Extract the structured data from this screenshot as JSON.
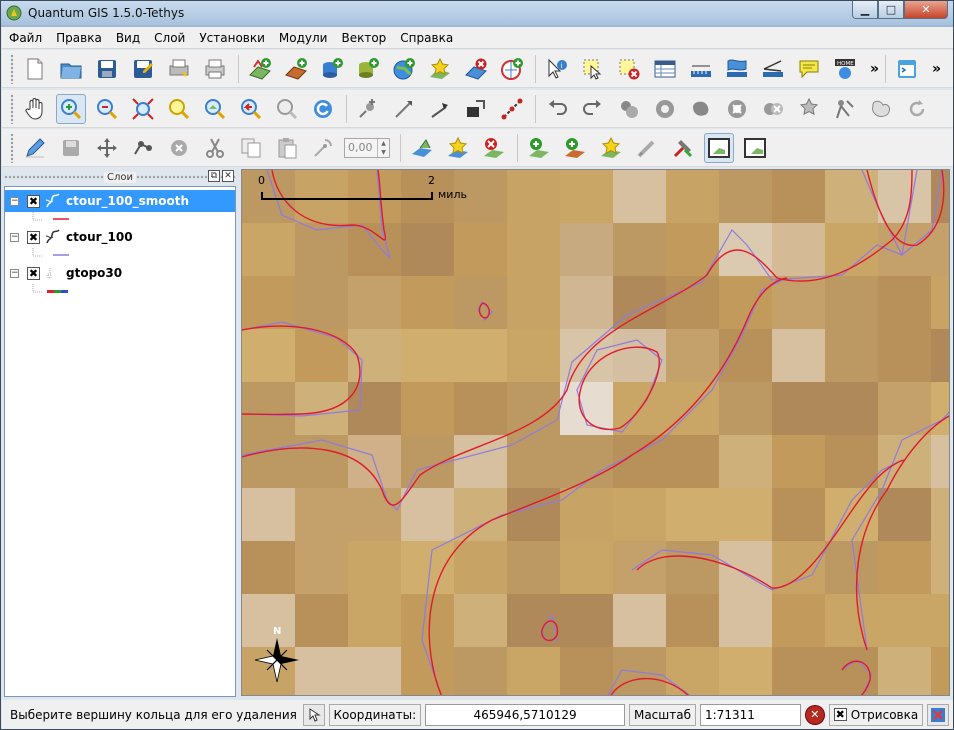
{
  "window": {
    "title": "Quantum GIS 1.5.0-Tethys",
    "controls": [
      "minimize",
      "maximize",
      "close"
    ]
  },
  "menubar": {
    "items": [
      "Файл",
      "Правка",
      "Вид",
      "Слой",
      "Установки",
      "Модули",
      "Вектор",
      "Справка"
    ]
  },
  "toolbars": {
    "file_tools": [
      "new-project-icon",
      "open-project-icon",
      "save-project-icon",
      "save-project-as-icon",
      "print-composer-icon",
      "print-icon"
    ],
    "layer_tools": [
      "add-vector-layer-icon",
      "add-raster-layer-icon",
      "add-postgis-layer-icon",
      "add-spatialite-layer-icon",
      "add-wms-layer-icon",
      "new-shapefile-icon",
      "remove-layer-icon",
      "add-wfs-layer-icon"
    ],
    "attribute_tools": [
      "identify-icon",
      "select-features-icon",
      "deselect-icon",
      "open-attribute-table-icon",
      "measure-line-icon",
      "measure-area-icon",
      "measure-angle-icon",
      "map-tips-icon",
      "home-bookmark-icon"
    ],
    "overflow_label": "»",
    "navigation_tools": [
      "pan-icon",
      "zoom-in-icon",
      "zoom-out-icon",
      "zoom-full-icon",
      "zoom-to-selection-icon",
      "zoom-to-layer-icon",
      "zoom-last-icon",
      "zoom-next-icon",
      "refresh-icon"
    ],
    "digitizing_tools": [
      "capture-point-icon",
      "capture-line-icon",
      "capture-polygon-icon",
      "move-feature-icon",
      "node-tool-icon",
      "undo-icon",
      "redo-icon",
      "simplify-feature-icon",
      "add-ring-icon",
      "add-island-icon",
      "delete-ring-icon",
      "delete-part-icon",
      "reshape-features-icon",
      "split-features-icon",
      "merge-features-icon",
      "rotate-label-icon"
    ],
    "editing_tools": [
      "toggle-editing-icon",
      "save-edits-icon",
      "move-icon",
      "node-icon",
      "delete-selected-icon",
      "cut-features-icon",
      "copy-features-icon",
      "paste-features-icon",
      "rotate-point-symbols-icon"
    ],
    "rotation_value": "0,00",
    "raster_tools": [
      "add-raster-icon",
      "new-raster-icon",
      "remove-raster-icon",
      "add-layer-to-overview-icon",
      "show-all-in-overview-icon",
      "add-all-to-overview-icon",
      "remove-all-from-overview-icon",
      "georeferencer-icon",
      "toggle-overview-icon",
      "hide-overview-icon"
    ]
  },
  "layers_panel": {
    "title": "Слои",
    "layers": [
      {
        "name": "ctour_100_smooth",
        "checked": "✖",
        "expanded": "−",
        "selected": true
      },
      {
        "name": "ctour_100",
        "checked": "✖",
        "expanded": "−",
        "selected": false
      },
      {
        "name": "gtopo30",
        "checked": "✖",
        "expanded": "−",
        "selected": false
      }
    ]
  },
  "map": {
    "scale_bar": {
      "start": "0",
      "end": "2",
      "unit": "миль"
    },
    "north_arrow_label": "N",
    "colors": {
      "raster_base": "#c7a466",
      "contour_smooth": "#e01b2c",
      "contour_raw": "#8f7be0"
    }
  },
  "statusbar": {
    "message": "Выберите вершину кольца для его удаления",
    "coords_label": "Координаты:",
    "coords_value": "465946,5710129",
    "scale_label": "Масштаб",
    "scale_value": "1:71311",
    "render_label": "Отрисовка",
    "render_checked": "✖"
  }
}
